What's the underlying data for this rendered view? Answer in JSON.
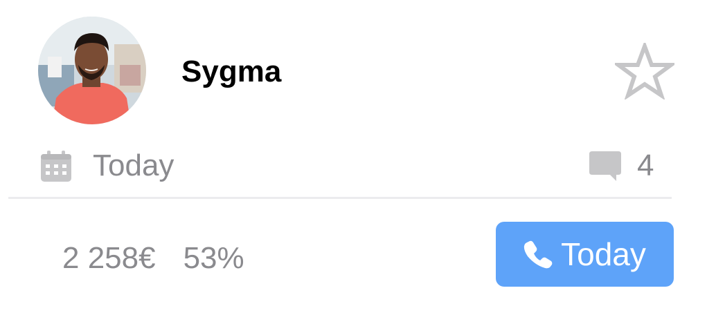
{
  "contact": {
    "name": "Sygma",
    "avatar_icon": "person-photo",
    "favorite_icon": "star-outline-icon"
  },
  "meta": {
    "date_label": "Today",
    "date_icon": "calendar-icon",
    "comments_count": "4",
    "comments_icon": "comment-icon"
  },
  "stats": {
    "amount": "2 258€",
    "percent": "53%"
  },
  "call_button": {
    "label": "Today",
    "icon": "phone-icon"
  },
  "colors": {
    "accent": "#5ea3f9",
    "muted_text": "#8a8a8e",
    "icon_gray": "#c6c6c8",
    "divider": "#ececee"
  }
}
